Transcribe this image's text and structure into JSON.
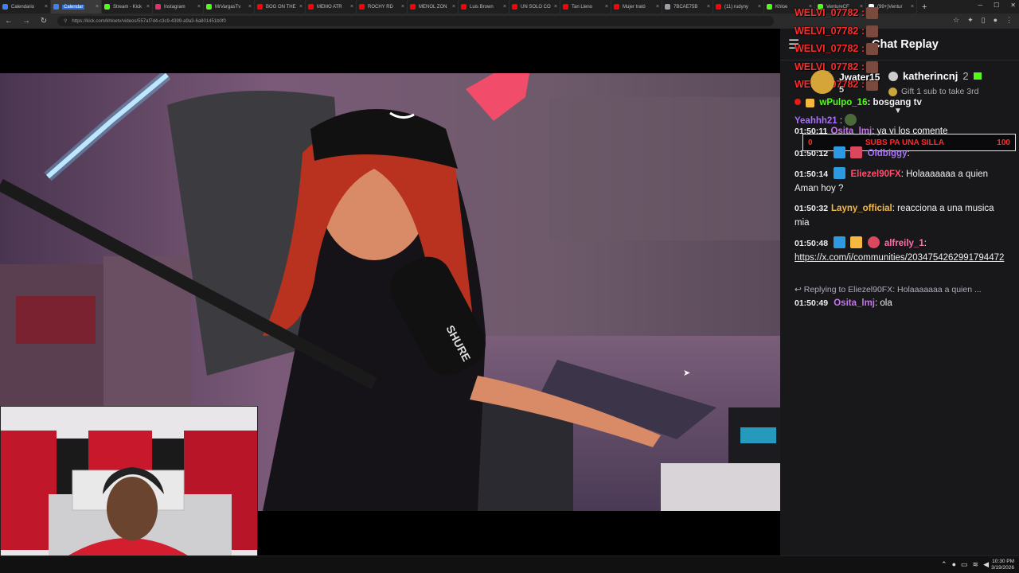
{
  "browser": {
    "tabs": [
      {
        "label": "Calendario",
        "favicon": "calendar-icon",
        "color": "#3b82f6"
      },
      {
        "label": "Calendar",
        "favicon": "calendar-icon",
        "color": "#3b82f6",
        "active": true
      },
      {
        "label": "Stream - Kick",
        "favicon": "kick-icon",
        "color": "#53fc18"
      },
      {
        "label": "Instagram",
        "favicon": "instagram-icon",
        "color": "#e1306c"
      },
      {
        "label": "MrVargasTv",
        "favicon": "kick-icon",
        "color": "#53fc18"
      },
      {
        "label": "BOG ON THE",
        "favicon": "youtube-icon",
        "color": "#ff0000"
      },
      {
        "label": "MEMO ATR",
        "favicon": "youtube-icon",
        "color": "#ff0000"
      },
      {
        "label": "ROCHY RD",
        "favicon": "youtube-icon",
        "color": "#ff0000"
      },
      {
        "label": "MENOL ZON",
        "favicon": "youtube-icon",
        "color": "#ff0000"
      },
      {
        "label": "Luis Brown",
        "favicon": "youtube-icon",
        "color": "#ff0000"
      },
      {
        "label": "UN SOLO CO",
        "favicon": "youtube-icon",
        "color": "#ff0000"
      },
      {
        "label": "Tan Lleno",
        "favicon": "youtube-icon",
        "color": "#ff0000"
      },
      {
        "label": "Mujer trató",
        "favicon": "youtube-icon",
        "color": "#ff0000"
      },
      {
        "label": "7BCAE75B",
        "favicon": "globe-icon",
        "color": "#9aa0a6"
      },
      {
        "label": "(11) rudyny",
        "favicon": "youtube-icon",
        "color": "#ff0000"
      },
      {
        "label": "Khloe",
        "favicon": "kick-icon",
        "color": "#53fc18"
      },
      {
        "label": "VentureCF",
        "favicon": "kick-icon",
        "color": "#53fc18"
      },
      {
        "label": "(99+)Ventur",
        "favicon": "tiktok-icon",
        "color": "#ffffff"
      }
    ],
    "new_tab": "+",
    "url": "https://kick.com/khloetv/videos/557af7d4-c3c9-4399-a9a3-6a801451b0f0"
  },
  "chat": {
    "title": "Chat Replay",
    "overlay_lines": [
      "WELVI_07782 :",
      "WELVI_07782 :",
      "WELVI_07782 :",
      "WELVI_07782 :",
      "WELVI_07782 :"
    ],
    "gifter_top": {
      "name": "Jwater15",
      "count": "5"
    },
    "gifter_leader": {
      "name": "katherincnj",
      "count": "2"
    },
    "gift_promo": "Gift 1 sub to take 3rd",
    "pinned": {
      "user": "wPulpo_16",
      "text": ": bosgang tv"
    },
    "sub_goal": {
      "left": "0",
      "label": "SUBS PA UNA SILLA",
      "right": "100"
    },
    "messages": [
      {
        "time": "",
        "user": "Yeahhh21",
        "user_color": "#a970ff",
        "text": ":"
      },
      {
        "time": "01:50:11",
        "user": "Osita_lmj",
        "user_color": "#c277e6",
        "text": ": ya vi los comente"
      },
      {
        "time": "01:50:12",
        "user": "Oldbiggy",
        "user_color": "#a970ff",
        "text": ":"
      },
      {
        "time": "01:50:14",
        "user": "Eliezel90FX",
        "user_color": "#ff4f6d",
        "text": ": Holaaaaaaa a quien Aman hoy ?"
      },
      {
        "time": "01:50:32",
        "user": "Layny_official",
        "user_color": "#f5b942",
        "text": ": reacciona a una musica mia"
      },
      {
        "time": "01:50:48",
        "user": "alfreily_1",
        "user_color": "#ff6fa8",
        "text": ":"
      },
      {
        "link": "https://x.com/i/communities/2034754262991794472"
      },
      {
        "reply": "Replying to Eliezel90FX: Holaaaaaaa a quien ..."
      },
      {
        "time": "01:50:49",
        "user": "Osita_lmj",
        "user_color": "#c277e6",
        "text": ": ola"
      }
    ]
  },
  "taskbar": {
    "time": "10:30 PM",
    "date": "3/19/2026"
  }
}
